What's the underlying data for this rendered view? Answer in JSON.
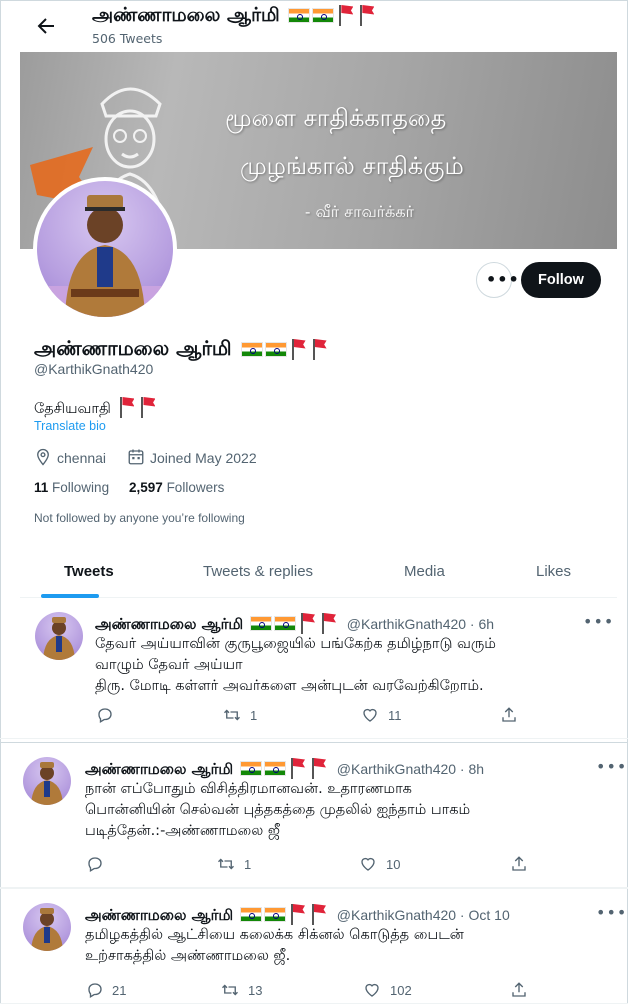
{
  "header": {
    "title": "அண்ணாமலை ஆர்மி",
    "tweet_count": "506 Tweets"
  },
  "banner": {
    "quote_line1": "மூளை சாதிக்காததை",
    "quote_line2": "முழங்கால் சாதிக்கும்",
    "quote_line3": "- வீர் சாவர்க்கர்"
  },
  "profile": {
    "name": "அண்ணாமலை ஆர்மி",
    "handle": "@KarthikGnath420",
    "bio": "தேசியவாதி",
    "translate_label": "Translate bio",
    "location": "chennai",
    "joined": "Joined May 2022",
    "following_count": "11",
    "following_label": "Following",
    "followers_count": "2,597",
    "followers_label": "Followers",
    "not_followed": "Not followed by anyone you’re following",
    "follow_label": "Follow",
    "more_label": "•••"
  },
  "tabs": [
    {
      "label": "Tweets",
      "active": true
    },
    {
      "label": "Tweets & replies",
      "active": false
    },
    {
      "label": "Media",
      "active": false
    },
    {
      "label": "Likes",
      "active": false
    }
  ],
  "tweets": [
    {
      "name": "அண்ணாமலை ஆர்மி",
      "meta": "@KarthikGnath420 · 6h",
      "line1": "தேவர் அய்யாவின் குருபூஜையில் பங்கேற்க தமிழ்நாடு வரும்",
      "line2": "வாழும் தேவர் அய்யா",
      "line3": "திரு. மோடி கள்ளர் அவர்களை அன்புடன் வரவேற்கிறோம்.",
      "replies": "",
      "retweets": "1",
      "likes": "11"
    },
    {
      "name": "அண்ணாமலை ஆர்மி",
      "meta": "@KarthikGnath420 · 8h",
      "line1": "நான் எப்போதும் விசித்திரமானவன். உதாரணமாக",
      "line2": "பொன்னியின் செல்வன் புத்தகத்தை முதலில் ஐந்தாம் பாகம்",
      "line3": "படித்தேன்.:-அண்ணாமலை ஜீ",
      "replies": "",
      "retweets": "1",
      "likes": "10"
    },
    {
      "name": "அண்ணாமலை ஆர்மி",
      "meta": "@KarthikGnath420 · Oct 10",
      "line1": "தமிழகத்தில் ஆட்சியை கலைக்க சிக்னல் கொடுத்த பைடன்",
      "line2": "உற்சாகத்தில் அண்ணாமலை ஜீ.",
      "line3": "",
      "replies": "21",
      "retweets": "13",
      "likes": "102"
    }
  ],
  "colors": {
    "accent": "#1d9bf0",
    "text": "#0f1419",
    "muted": "#536471",
    "red_flag": "#e0243a"
  }
}
